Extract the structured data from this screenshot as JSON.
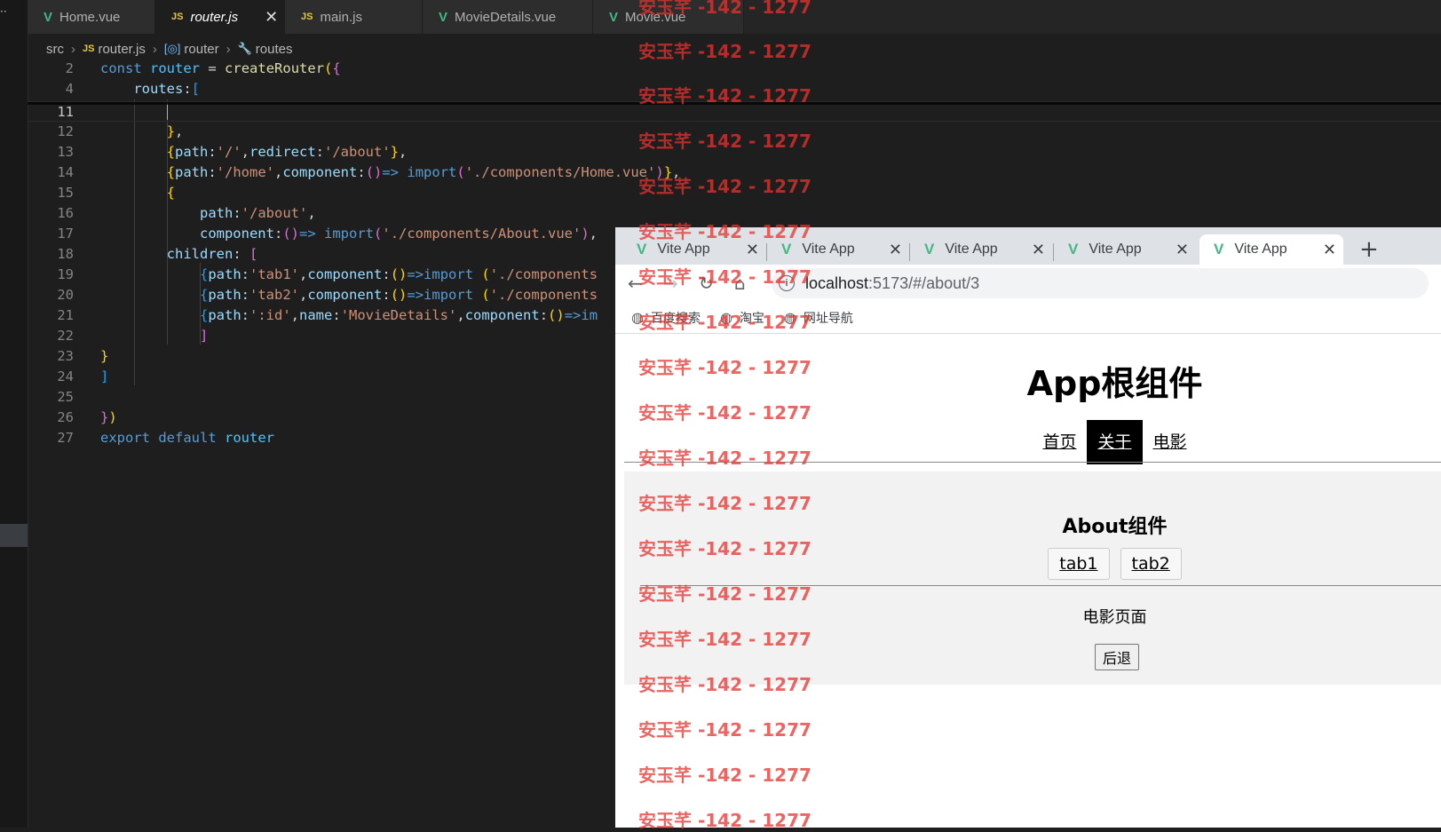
{
  "editor": {
    "tabs": [
      {
        "label": "Home.vue",
        "type": "vue"
      },
      {
        "label": "router.js",
        "type": "js",
        "active": true
      },
      {
        "label": "main.js",
        "type": "js"
      },
      {
        "label": "MovieDetails.vue",
        "type": "vue"
      },
      {
        "label": "Movie.vue",
        "type": "vue"
      }
    ],
    "breadcrumb": [
      "src",
      "router.js",
      "router",
      "routes"
    ],
    "line_numbers": [
      "2",
      "4",
      "11",
      "12",
      "13",
      "14",
      "15",
      "16",
      "17",
      "18",
      "19",
      "20",
      "21",
      "22",
      "23",
      "24",
      "25",
      "26",
      "27"
    ],
    "code": {
      "l2": [
        "const",
        "router",
        "=",
        "createRouter",
        "(",
        "{"
      ],
      "l4": [
        "routes",
        ":",
        "["
      ],
      "l12": [
        "}",
        ","
      ],
      "l13": [
        "{",
        "path",
        ":",
        "'/'",
        ",",
        "redirect",
        ":",
        "'/about'",
        "}",
        ","
      ],
      "l14": [
        "{",
        "path",
        ":",
        "'/home'",
        ",",
        "component",
        ":",
        "()",
        "=>",
        "import",
        "(",
        "'./components/Home.vue'",
        ")",
        "}",
        ","
      ],
      "l15": [
        "{"
      ],
      "l16": [
        "path",
        ":",
        "'/about'",
        ","
      ],
      "l17": [
        "component",
        ":",
        "()",
        "=>",
        "import",
        "(",
        "'./components/About.vue'",
        ")",
        ","
      ],
      "l18": [
        "children",
        ":",
        "["
      ],
      "l19": [
        "{",
        "path",
        ":",
        "'tab1'",
        ",",
        "component",
        ":",
        "()",
        "=>",
        "import",
        "(",
        "'./components"
      ],
      "l20": [
        "{",
        "path",
        ":",
        "'tab2'",
        ",",
        "component",
        ":",
        "()",
        "=>",
        "import",
        "(",
        "'./components"
      ],
      "l21": [
        "{",
        "path",
        ":",
        "':id'",
        ",",
        "name",
        ":",
        "'MovieDetails'",
        ",",
        "component",
        ":",
        "()",
        "=>",
        "im"
      ],
      "l22": [
        "]"
      ],
      "l23": [
        "}"
      ],
      "l24": [
        "]"
      ],
      "l26": [
        "}",
        ")"
      ],
      "l27": [
        "export",
        "default",
        "router"
      ]
    }
  },
  "browser": {
    "tabs": [
      "Vite App",
      "Vite App",
      "Vite App",
      "Vite App",
      "Vite App"
    ],
    "new_tab": "+",
    "url_host": "localhost",
    "url_rest": ":5173/#/about/3",
    "bookmarks": [
      "百度搜索",
      "淘宝",
      "网址导航"
    ],
    "page": {
      "title": "App根组件",
      "nav": [
        "首页",
        "关于",
        "电影"
      ],
      "active_nav": "关于",
      "about_title": "About组件",
      "about_tabs": [
        "tab1",
        "tab2"
      ],
      "movie_text": "电影页面",
      "back_button": "后退"
    }
  },
  "watermark": "安玉芊 -142 - 1277",
  "colors": {
    "editor_bg": "#1e1e1e",
    "keyword": "#569cd6",
    "string": "#ce9178",
    "function": "#dcdcaa",
    "property": "#9cdcfe",
    "vue_green": "#42b883",
    "watermark_red": "#e8322e"
  }
}
